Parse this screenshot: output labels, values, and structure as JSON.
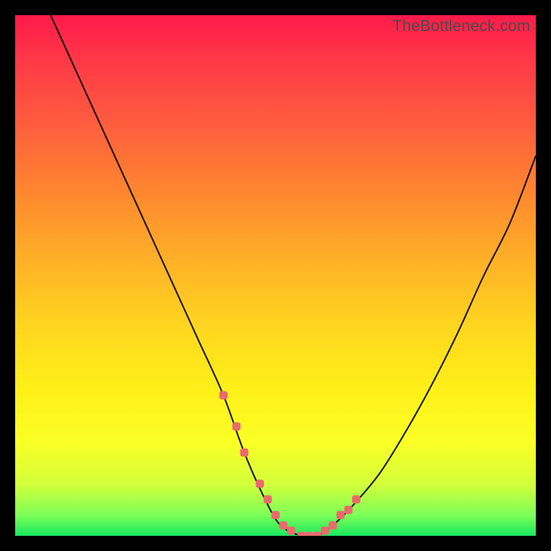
{
  "watermark": "TheBottleneck.com",
  "colors": {
    "background": "#000000",
    "curve": "#000000",
    "dots": "#e86a6d"
  },
  "chart_data": {
    "type": "line",
    "title": "",
    "xlabel": "",
    "ylabel": "",
    "xlim": [
      0,
      100
    ],
    "ylim": [
      0,
      100
    ],
    "grid": false,
    "description": "Bottleneck percentage curve with minimum around center, overlaid on vertical red-to-green gradient representing severity (top=high bottleneck=red, bottom=no bottleneck=green).",
    "series": [
      {
        "name": "bottleneck-curve",
        "x": [
          0,
          5,
          10,
          15,
          20,
          25,
          30,
          35,
          40,
          44,
          48,
          51,
          55,
          58,
          61,
          65,
          70,
          75,
          80,
          85,
          90,
          95,
          100
        ],
        "values": [
          115,
          104,
          93,
          82,
          71,
          60,
          49,
          38,
          27,
          16,
          7,
          2,
          0,
          0,
          2,
          6,
          12,
          20,
          29,
          39,
          50,
          60,
          73
        ]
      }
    ],
    "highlighted_points": {
      "name": "near-minimum-dots",
      "x": [
        40,
        42.5,
        44,
        47,
        48.5,
        50,
        51.5,
        53,
        55,
        56.5,
        58,
        59.5,
        61,
        62.5,
        64,
        65.5
      ],
      "values": [
        27,
        21,
        16,
        10,
        7,
        4,
        2,
        1,
        0,
        0,
        0,
        1,
        2,
        4,
        5,
        7
      ]
    }
  }
}
